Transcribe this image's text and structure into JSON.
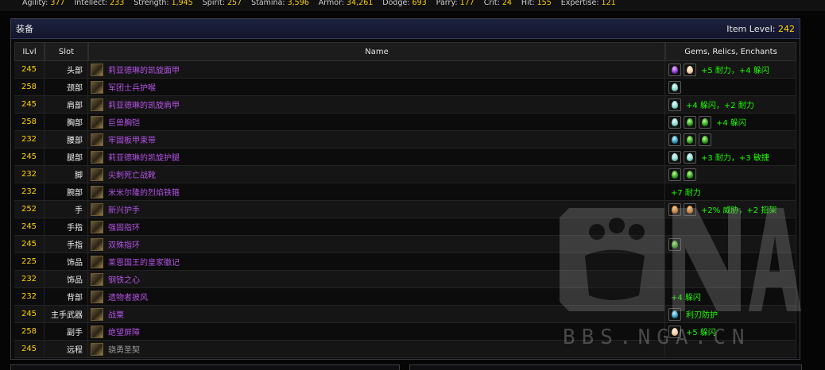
{
  "stats": [
    {
      "label": "Agility:",
      "value": "377"
    },
    {
      "label": "Intellect:",
      "value": "233"
    },
    {
      "label": "Strength:",
      "value": "1,945"
    },
    {
      "label": "Spirit:",
      "value": "257"
    },
    {
      "label": "Stamina:",
      "value": "3,596"
    },
    {
      "label": "Armor:",
      "value": "34,261"
    },
    {
      "label": "Dodge:",
      "value": "693"
    },
    {
      "label": "Parry:",
      "value": "177"
    },
    {
      "label": "Crit:",
      "value": "24"
    },
    {
      "label": "Hit:",
      "value": "155"
    },
    {
      "label": "Expertise:",
      "value": "121"
    }
  ],
  "panel": {
    "title": "装备",
    "item_level_label": "Item Level:",
    "item_level_value": "242"
  },
  "columns": {
    "ilvl": "ILvl",
    "slot": "Slot",
    "name": "Name",
    "gems": "Gems, Relics, Enchants"
  },
  "rows": [
    {
      "ilvl": "245",
      "slot": "头部",
      "name": "莉亚德琳的凯旋面甲",
      "quality": "epic",
      "gems": [
        "purple",
        "pale"
      ],
      "enchant": "+5 耐力，+4 躲闪"
    },
    {
      "ilvl": "258",
      "slot": "颈部",
      "name": "军团士兵护喉",
      "quality": "epic",
      "gems": [
        "prismatic"
      ],
      "enchant": ""
    },
    {
      "ilvl": "245",
      "slot": "肩部",
      "name": "莉亚德琳的凯旋肩甲",
      "quality": "epic",
      "gems": [
        "prismatic"
      ],
      "enchant": "+4 躲闪，+2 耐力"
    },
    {
      "ilvl": "258",
      "slot": "胸部",
      "name": "巨兽胸铠",
      "quality": "epic",
      "gems": [
        "prismatic",
        "green",
        "green"
      ],
      "enchant": "+4 躲闪"
    },
    {
      "ilvl": "232",
      "slot": "腰部",
      "name": "牢固板甲束带",
      "quality": "epic",
      "gems": [
        "teal",
        "green",
        "green"
      ],
      "enchant": ""
    },
    {
      "ilvl": "245",
      "slot": "腿部",
      "name": "莉亚德琳的凯旋护腿",
      "quality": "epic",
      "gems": [
        "prismatic",
        "prismatic"
      ],
      "enchant": "+3 耐力，+3 敏捷"
    },
    {
      "ilvl": "232",
      "slot": "脚",
      "name": "尖刺死亡战靴",
      "quality": "epic",
      "gems": [
        "green",
        "green"
      ],
      "enchant": ""
    },
    {
      "ilvl": "232",
      "slot": "腕部",
      "name": "米米尔隆的烈焰铁箍",
      "quality": "epic",
      "gems": [],
      "enchant": "+7 耐力"
    },
    {
      "ilvl": "252",
      "slot": "手",
      "name": "新兴护手",
      "quality": "epic",
      "gems": [
        "orange",
        "orange"
      ],
      "enchant": "+2% 威胁，+2 招架"
    },
    {
      "ilvl": "245",
      "slot": "手指",
      "name": "强固指环",
      "quality": "epic",
      "gems": [],
      "enchant": ""
    },
    {
      "ilvl": "245",
      "slot": "手指",
      "name": "双殊指环",
      "quality": "epic",
      "gems": [
        "green"
      ],
      "enchant": ""
    },
    {
      "ilvl": "225",
      "slot": "饰品",
      "name": "莱恩国王的皇家徽记",
      "quality": "epic",
      "gems": [],
      "enchant": ""
    },
    {
      "ilvl": "232",
      "slot": "饰品",
      "name": "钢铁之心",
      "quality": "epic",
      "gems": [],
      "enchant": ""
    },
    {
      "ilvl": "232",
      "slot": "背部",
      "name": "遗物者披风",
      "quality": "epic",
      "gems": [],
      "enchant": "+4 躲闪"
    },
    {
      "ilvl": "245",
      "slot": "主手武器",
      "name": "战栗",
      "quality": "epic",
      "gems": [
        "teal"
      ],
      "enchant": "利刃防护"
    },
    {
      "ilvl": "258",
      "slot": "副手",
      "name": "绝望屏障",
      "quality": "epic",
      "gems": [
        "pale"
      ],
      "enchant": "+5 躲闪"
    },
    {
      "ilvl": "245",
      "slot": "远程",
      "name": "骁勇圣契",
      "quality": "common",
      "gems": [],
      "enchant": ""
    }
  ],
  "watermark": {
    "url": "BBS.NGA.CN"
  }
}
